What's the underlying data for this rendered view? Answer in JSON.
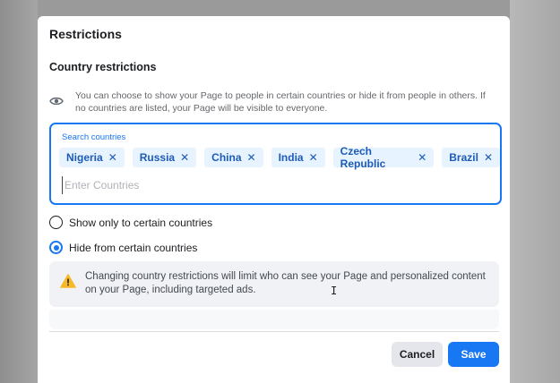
{
  "dialog": {
    "title": "Restrictions",
    "section_title": "Country restrictions",
    "info_text": "You can choose to show your Page to people in certain countries or hide it from people in others. If no countries are listed, your Page will be visible to everyone."
  },
  "search": {
    "label": "Search countries",
    "placeholder": "Enter Countries",
    "value": "",
    "chips": [
      "Nigeria",
      "Russia",
      "China",
      "India",
      "Czech Republic",
      "Brazil"
    ],
    "chip_remove_glyph": "✕"
  },
  "options": {
    "show_only": {
      "label": "Show only to certain countries",
      "checked": false
    },
    "hide_from": {
      "label": "Hide from certain countries",
      "checked": true
    }
  },
  "warning": {
    "text": "Changing country restrictions will limit who can see your Page and personalized content on your Page, including targeted ads."
  },
  "footer": {
    "cancel_label": "Cancel",
    "save_label": "Save"
  },
  "colors": {
    "accent": "#1877f2",
    "chip_bg": "#e7f3ff",
    "warning_icon": "#f7b928"
  },
  "icons": {
    "info": "eye-icon",
    "warning": "warning-triangle-icon",
    "chip_remove": "close-icon"
  }
}
